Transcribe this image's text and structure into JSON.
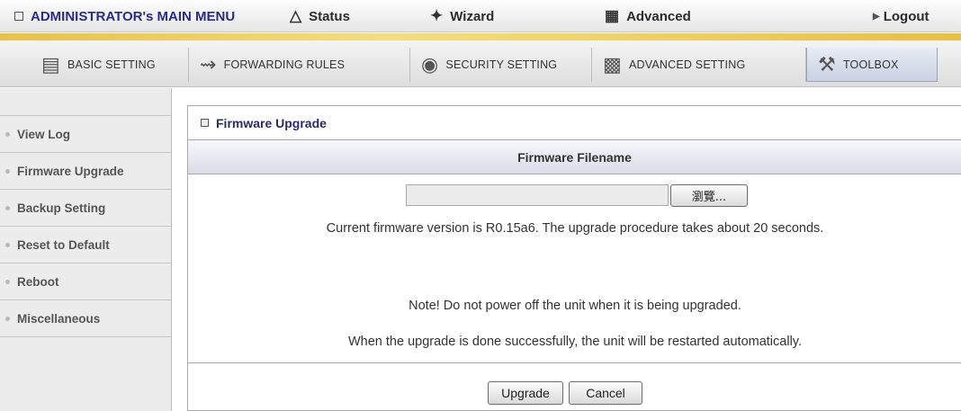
{
  "topbar": {
    "admin_label": "ADMINISTRATOR's MAIN MENU",
    "status_label": "Status",
    "wizard_label": "Wizard",
    "advanced_label": "Advanced",
    "logout_label": "Logout"
  },
  "tabs": [
    {
      "label": "BASIC SETTING",
      "icon": "folder-icon"
    },
    {
      "label": "FORWARDING RULES",
      "icon": "arrows-icon"
    },
    {
      "label": "SECURITY SETTING",
      "icon": "eye-icon"
    },
    {
      "label": "ADVANCED SETTING",
      "icon": "router-icon"
    },
    {
      "label": "TOOLBOX",
      "icon": "toolbox-icon"
    }
  ],
  "sidebar": {
    "items": [
      {
        "label": "View Log"
      },
      {
        "label": "Firmware Upgrade"
      },
      {
        "label": "Backup Setting"
      },
      {
        "label": "Reset to Default"
      },
      {
        "label": "Reboot"
      },
      {
        "label": "Miscellaneous"
      }
    ]
  },
  "panel": {
    "title": "Firmware Upgrade",
    "section_header": "Firmware Filename",
    "file_value": "",
    "browse_label": "瀏覽...",
    "version_text": "Current firmware version is R0.15a6. The upgrade procedure takes about 20 seconds.",
    "note_text": "Note! Do not power off the unit when it is being upgraded.",
    "restart_text": "When the upgrade is done successfully, the unit will be restarted automatically.",
    "upgrade_label": "Upgrade",
    "cancel_label": "Cancel"
  },
  "colors": {
    "accent_gold": "#e9c14a",
    "title_blue": "#2a2a6a"
  }
}
